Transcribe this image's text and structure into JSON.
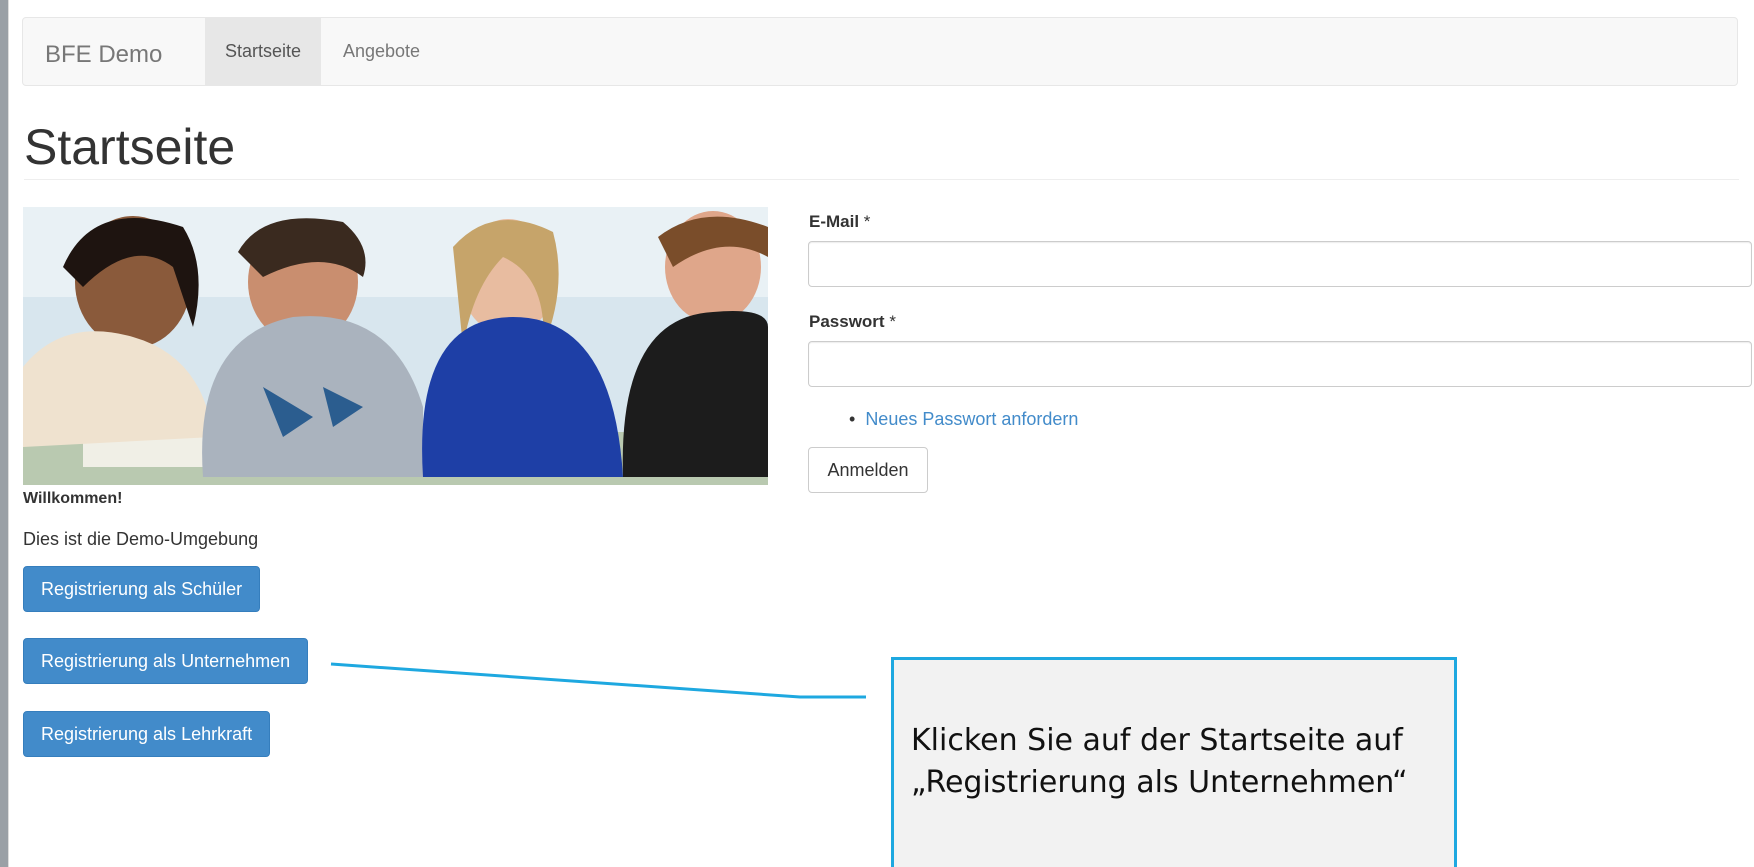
{
  "navbar": {
    "brand": "BFE Demo",
    "items": [
      {
        "label": "Startseite",
        "active": true
      },
      {
        "label": "Angebote",
        "active": false
      }
    ]
  },
  "page_title": "Startseite",
  "welcome": {
    "heading": "Willkommen!",
    "text": "Dies ist die Demo-Umgebung"
  },
  "buttons": {
    "schueler": "Registrierung als Schüler",
    "unternehmen": "Registrierung als Unternehmen",
    "lehrkraft": "Registrierung als Lehrkraft"
  },
  "login": {
    "email_label": "E-Mail",
    "email_value": "",
    "password_label": "Passwort",
    "password_value": "",
    "required_mark": "*",
    "reset_link": "Neues Passwort anfordern",
    "submit": "Anmelden"
  },
  "callout": {
    "line1": "Klicken Sie auf der Startseite auf",
    "line2": "„Registrierung als Unternehmen“"
  },
  "colors": {
    "primary": "#428bca",
    "callout_border": "#1ea8e0",
    "link": "#428bca"
  }
}
